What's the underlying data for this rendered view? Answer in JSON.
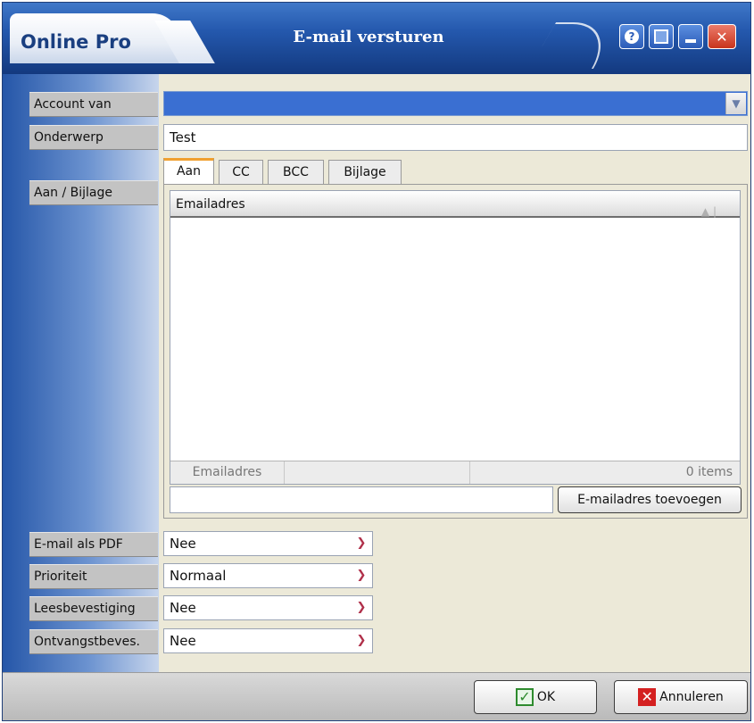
{
  "window": {
    "brand": "Online Pro",
    "title": "E-mail versturen",
    "buttons": {
      "help": "?",
      "close": "✕"
    }
  },
  "labels": {
    "account": "Account van",
    "subject": "Onderwerp",
    "to_attach": "Aan / Bijlage",
    "pdf": "E-mail als PDF",
    "priority": "Prioriteit",
    "read_receipt": "Leesbevestiging",
    "delivery_receipt": "Ontvangstbeves."
  },
  "fields": {
    "account": "",
    "subject": "Test"
  },
  "tabs": [
    "Aan",
    "CC",
    "BCC",
    "Bijlage"
  ],
  "grid": {
    "column": "Emailadres",
    "footer_col": "Emailadres",
    "count": "0 items"
  },
  "add_email": {
    "value": "",
    "button": "E-mailadres toevoegen"
  },
  "selects": {
    "pdf": "Nee",
    "priority": "Normaal",
    "read_receipt": "Nee",
    "delivery_receipt": "Nee"
  },
  "footer": {
    "ok": "OK",
    "cancel": "Annuleren"
  },
  "icons": {
    "dropdown": "chevron-down-icon",
    "sort": "sort-up-icon",
    "ok": "check-icon",
    "cancel": "x-icon"
  },
  "colors": {
    "titlebar": "#2458ad",
    "account_bg": "#3a6fd2",
    "tab_accent": "#f0a030",
    "ok_check": "#2e8b2e",
    "cancel_x": "#d42020"
  }
}
